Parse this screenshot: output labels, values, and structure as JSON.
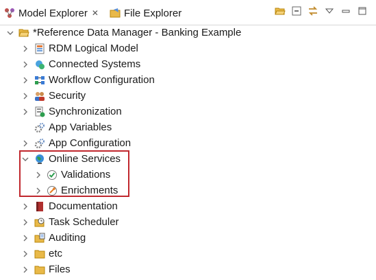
{
  "tabs": {
    "model_explorer": "Model Explorer",
    "close_glyph": "✕",
    "file_explorer": "File Explorer"
  },
  "toolbar": {
    "icons": [
      "folder-open-icon",
      "collapse-all-icon",
      "link-with-editor-icon",
      "view-menu-icon",
      "minimize-icon",
      "maximize-icon"
    ]
  },
  "tree": {
    "root": "*Reference Data Manager - Banking Example",
    "items": [
      {
        "label": "RDM Logical Model",
        "icon": "logical-model-icon"
      },
      {
        "label": "Connected Systems",
        "icon": "connected-systems-icon"
      },
      {
        "label": "Workflow Configuration",
        "icon": "workflow-icon"
      },
      {
        "label": "Security",
        "icon": "security-icon"
      },
      {
        "label": "Synchronization",
        "icon": "synchronization-icon"
      },
      {
        "label": "App Variables",
        "icon": "gear-icon"
      },
      {
        "label": "App Configuration",
        "icon": "gear-icon"
      },
      {
        "label": "Online Services",
        "icon": "globe-icon"
      },
      {
        "label": "Validations",
        "icon": "validation-icon"
      },
      {
        "label": "Enrichments",
        "icon": "enrichment-icon"
      },
      {
        "label": "Documentation",
        "icon": "book-icon"
      },
      {
        "label": "Task Scheduler",
        "icon": "task-scheduler-icon"
      },
      {
        "label": "Auditing",
        "icon": "auditing-icon"
      },
      {
        "label": "etc",
        "icon": "folder-icon"
      },
      {
        "label": "Files",
        "icon": "folder-icon"
      }
    ]
  },
  "colors": {
    "highlight_border": "#c0272d",
    "folder": "#e9b949",
    "chevron": "#6f6f6f"
  }
}
